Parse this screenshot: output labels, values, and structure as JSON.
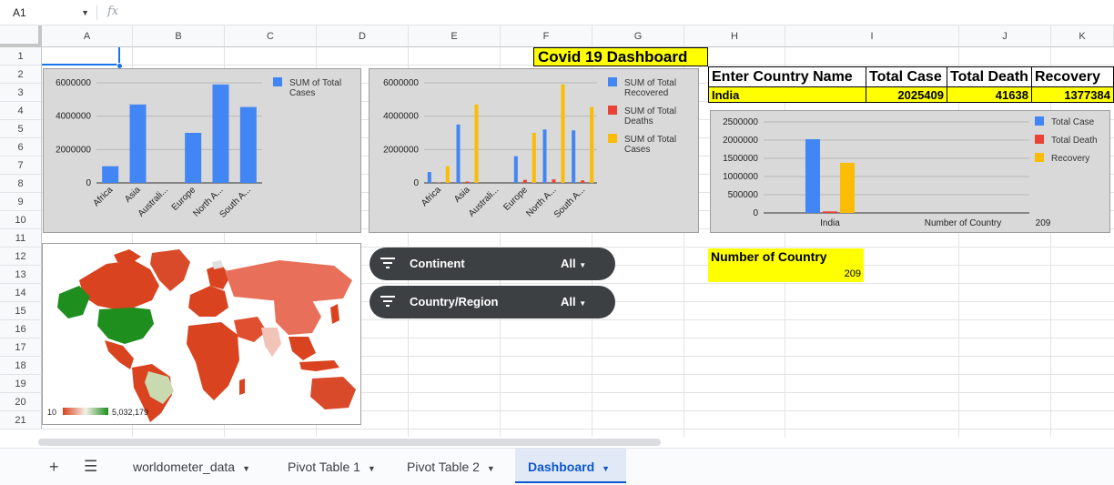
{
  "namebox": {
    "value": "A1",
    "fx": "fx"
  },
  "columns": [
    "A",
    "B",
    "C",
    "D",
    "E",
    "F",
    "G",
    "H",
    "I",
    "J",
    "K"
  ],
  "rows": [
    "1",
    "2",
    "3",
    "4",
    "5",
    "6",
    "7",
    "8",
    "9",
    "10",
    "11",
    "12",
    "13",
    "14",
    "15",
    "16",
    "17",
    "18",
    "19",
    "20",
    "21"
  ],
  "dashboard": {
    "title": "Covid 19 Dashboard"
  },
  "country_table": {
    "headers": [
      "Enter Country Name",
      "Total Case",
      "Total Death",
      "Recovery"
    ],
    "row": [
      "India",
      "2025409",
      "41638",
      "1377384"
    ]
  },
  "number_of_country": {
    "label": "Number of Country",
    "value": "209"
  },
  "filters": [
    {
      "label": "Continent",
      "value": "All"
    },
    {
      "label": "Country/Region",
      "value": "All"
    }
  ],
  "map": {
    "legend_min": "10",
    "legend_max": "5,032,179"
  },
  "sheet_tabs": [
    {
      "label": "worldometer_data",
      "active": false
    },
    {
      "label": "Pivot Table 1",
      "active": false
    },
    {
      "label": "Pivot Table 2",
      "active": false
    },
    {
      "label": "Dashboard",
      "active": true
    }
  ],
  "colors": {
    "blue": "#4285f4",
    "red": "#ea4335",
    "yellow": "#fbbc04",
    "highlight": "#ffff00"
  },
  "chart_data": [
    {
      "type": "bar",
      "categories": [
        "Africa",
        "Asia",
        "Australi...",
        "Europe",
        "North A...",
        "South A..."
      ],
      "series": [
        {
          "name": "SUM of Total Cases",
          "values": [
            1000000,
            4700000,
            0,
            3000000,
            5900000,
            4550000
          ],
          "color": "#4285f4"
        }
      ],
      "ylim": [
        0,
        6000000
      ],
      "yticks": [
        "6000000",
        "4000000",
        "2000000",
        "0"
      ],
      "legend": "right"
    },
    {
      "type": "bar",
      "categories": [
        "Africa",
        "Asia",
        "Australi...",
        "Europe",
        "North A...",
        "South A..."
      ],
      "series": [
        {
          "name": "SUM of Total Recovered",
          "values": [
            650000,
            3500000,
            0,
            1600000,
            3200000,
            3150000
          ],
          "color": "#4285f4"
        },
        {
          "name": "SUM of Total Deaths",
          "values": [
            20000,
            80000,
            0,
            180000,
            210000,
            150000
          ],
          "color": "#ea4335"
        },
        {
          "name": "SUM of Total Cases",
          "values": [
            1000000,
            4700000,
            0,
            3000000,
            5900000,
            4550000
          ],
          "color": "#fbbc04"
        }
      ],
      "ylim": [
        0,
        6000000
      ],
      "yticks": [
        "6000000",
        "4000000",
        "2000000",
        "0"
      ],
      "legend": "right"
    },
    {
      "type": "bar",
      "categories": [
        "India",
        "Number of Country"
      ],
      "category_values": [
        "",
        "209"
      ],
      "series": [
        {
          "name": "Total Case",
          "values": [
            2025409,
            0
          ],
          "color": "#4285f4"
        },
        {
          "name": "Total Death",
          "values": [
            41638,
            0
          ],
          "color": "#ea4335"
        },
        {
          "name": "Recovery",
          "values": [
            1377384,
            0
          ],
          "color": "#fbbc04"
        }
      ],
      "ylim": [
        0,
        2500000
      ],
      "yticks": [
        "2500000",
        "2000000",
        "1500000",
        "1000000",
        "500000",
        "0"
      ],
      "legend": "right"
    }
  ]
}
